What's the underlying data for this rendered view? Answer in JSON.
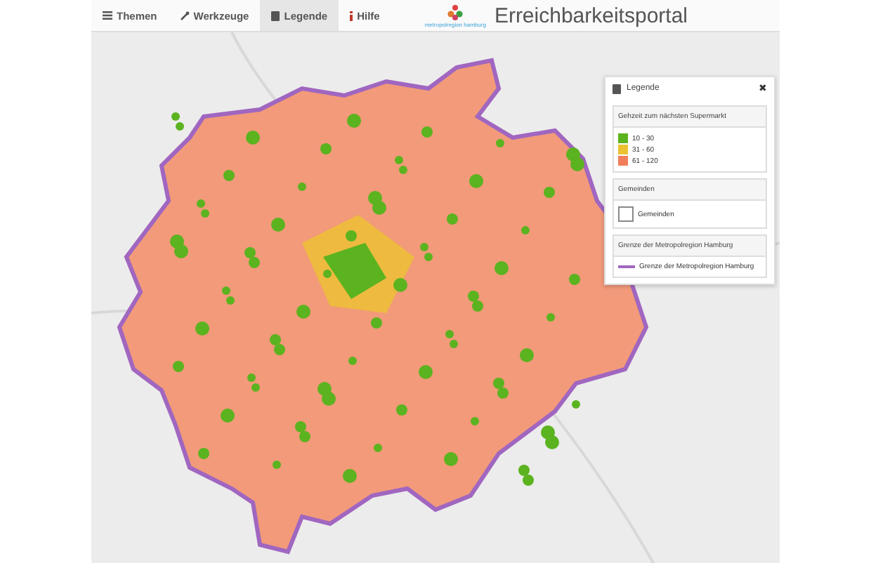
{
  "toolbar": {
    "tabs": [
      {
        "label": "Themen",
        "selected": false
      },
      {
        "label": "Werkzeuge",
        "selected": false
      },
      {
        "label": "Legende",
        "selected": true
      },
      {
        "label": "Hilfe",
        "selected": false
      }
    ]
  },
  "logo": {
    "caption": "metropolregion hamburg"
  },
  "title": "Erreichbarkeitsportal",
  "legend": {
    "title": "Legende",
    "close": "✖",
    "sections": [
      {
        "title": "Gehzeit zum nächsten Supermarkt",
        "items": [
          {
            "kind": "fill",
            "color": "#5bb31f",
            "label": "10 - 30"
          },
          {
            "kind": "fill",
            "color": "#ecc232",
            "label": "31 - 60"
          },
          {
            "kind": "fill",
            "color": "#f07f5c",
            "label": "61 - 120"
          }
        ]
      },
      {
        "title": "Gemeinden",
        "items": [
          {
            "kind": "outline",
            "color": "#888888",
            "label": "Gemeinden"
          }
        ]
      },
      {
        "title": "Grenze der Metropolregion Hamburg",
        "items": [
          {
            "kind": "line",
            "color": "#a066c0",
            "label": "Grenze der Metropolregion Hamburg"
          }
        ]
      }
    ]
  }
}
